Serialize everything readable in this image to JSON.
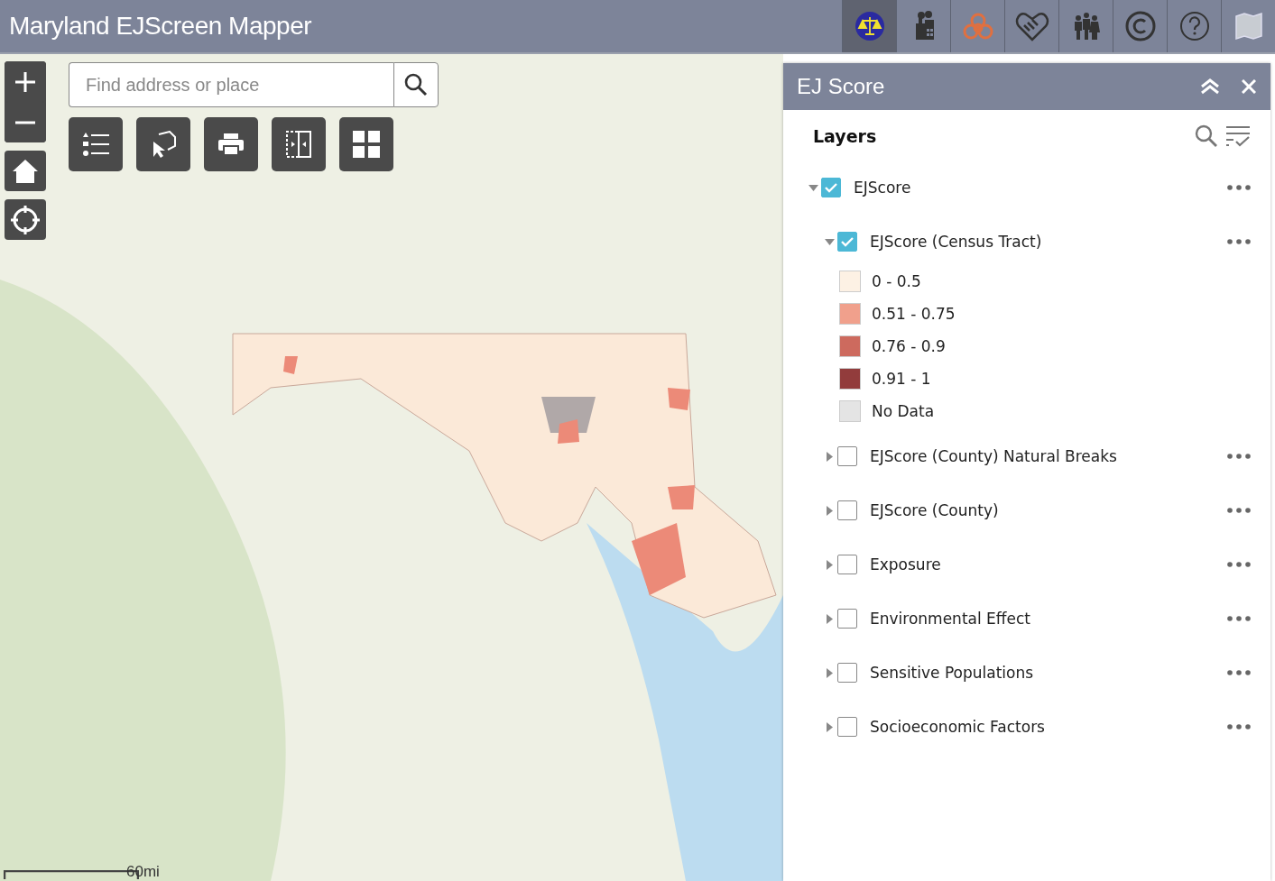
{
  "app_title": "Maryland EJScreen Mapper",
  "header_tools": [
    {
      "kind": "scales",
      "selected": true
    },
    {
      "kind": "factory",
      "selected": false
    },
    {
      "kind": "biohazard",
      "selected": false
    },
    {
      "kind": "handshake",
      "selected": false
    },
    {
      "kind": "people",
      "selected": false
    },
    {
      "kind": "copyright",
      "selected": false
    },
    {
      "kind": "help",
      "selected": false
    },
    {
      "kind": "map",
      "selected": false
    }
  ],
  "search": {
    "placeholder": "Find address or place"
  },
  "map_tools": [
    {
      "kind": "legend"
    },
    {
      "kind": "select"
    },
    {
      "kind": "print"
    },
    {
      "kind": "swipe"
    },
    {
      "kind": "grid"
    }
  ],
  "scale_bar": "60mi",
  "panel": {
    "title": "EJ Score",
    "section_title": "Layers",
    "layers": [
      {
        "name": "EJScore",
        "checked": true,
        "expanded": true,
        "children": [
          {
            "name": "EJScore (Census Tract)",
            "checked": true,
            "expanded": true,
            "legend": [
              {
                "label": "0 - 0.5",
                "color": "#fdf1e4"
              },
              {
                "label": "0.51 - 0.75",
                "color": "#f0a08c"
              },
              {
                "label": "0.76 - 0.9",
                "color": "#cd6a5e"
              },
              {
                "label": "0.91 - 1",
                "color": "#923c3c"
              },
              {
                "label": "No Data",
                "color": "#e4e4e4"
              }
            ]
          },
          {
            "name": "EJScore (County) Natural Breaks",
            "checked": false,
            "expanded": false
          },
          {
            "name": "EJScore (County)",
            "checked": false,
            "expanded": false
          },
          {
            "name": "Exposure",
            "checked": false,
            "expanded": false
          },
          {
            "name": "Environmental Effect",
            "checked": false,
            "expanded": false
          },
          {
            "name": "Sensitive Populations",
            "checked": false,
            "expanded": false
          },
          {
            "name": "Socioeconomic Factors",
            "checked": false,
            "expanded": false
          }
        ]
      }
    ]
  }
}
